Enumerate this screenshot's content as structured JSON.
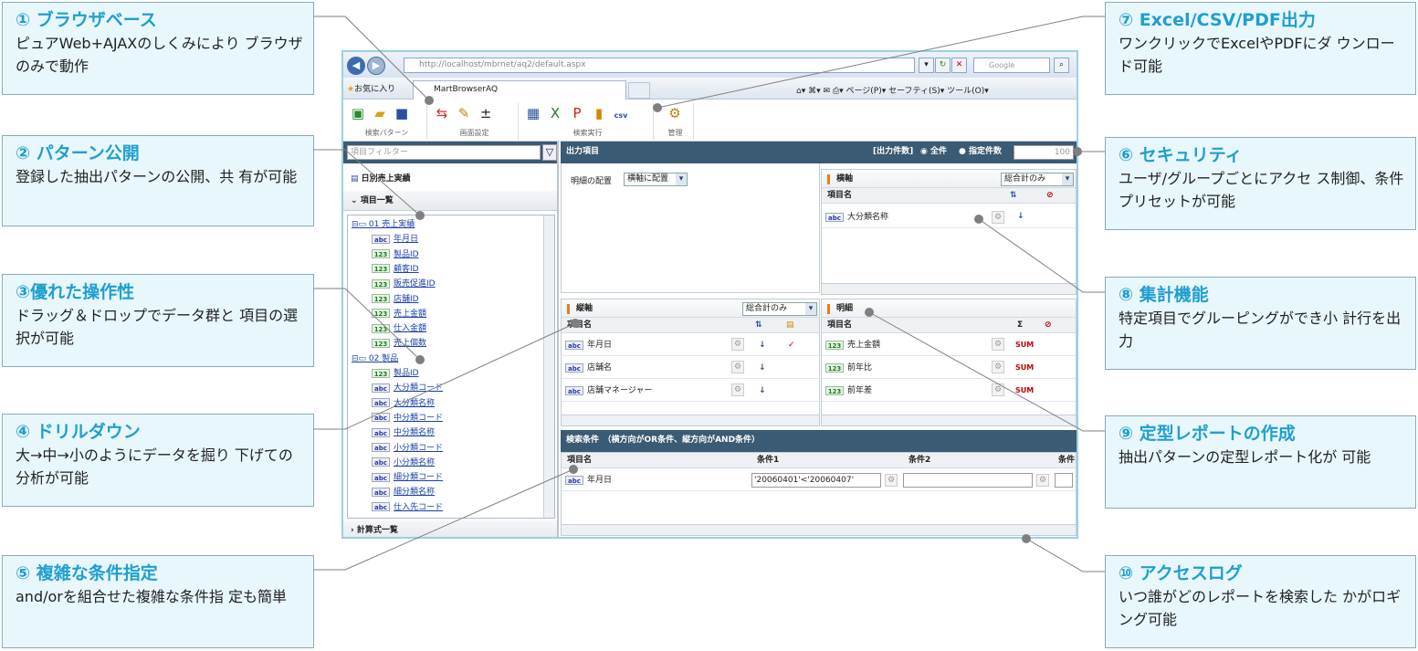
{
  "callouts": [
    {
      "title": "① ブラウザベース",
      "desc": "ピュアWeb+AJAXのしくみにより ブラウザのみで動作"
    },
    {
      "title": "② パターン公開",
      "desc": "登録した抽出パターンの公開、共 有が可能"
    },
    {
      "title": "③優れた操作性",
      "desc": "ドラッグ＆ドロップでデータ群と 項目の選択が可能"
    },
    {
      "title": "④ ドリルダウン",
      "desc": "大→中→小のようにデータを掘り 下げての分析が可能"
    },
    {
      "title": "⑤ 複雑な条件指定",
      "desc": "and/orを組合せた複雑な条件指 定も簡単"
    },
    {
      "title": "⑦ Excel/CSV/PDF出力",
      "desc": "ワンクリックでExcelやPDFにダ ウンロード可能"
    },
    {
      "title": "⑥ セキュリティ",
      "desc": "ユーザ/グループごとにアクセ ス制御、条件プリセットが可能"
    },
    {
      "title": "⑧ 集計機能",
      "desc": "特定項目でグルーピングができ小 計行を出力"
    },
    {
      "title": "⑨ 定型レポートの作成",
      "desc": "抽出パターンの定型レポート化が 可能"
    },
    {
      "title": "⑩ アクセスログ",
      "desc": "いつ誰がどのレポートを検索した かがロギング可能"
    }
  ],
  "browser": {
    "url": "http://localhost/mbrnet/aq2/default.aspx",
    "search_placeholder": "Google",
    "favorites": "お気に入り",
    "tab_title": "MartBrowserAQ",
    "tools": "ページ(P)▾  セーフティ(S)▾  ツール(O)▾"
  },
  "toolbar": {
    "groups": [
      "検索パターン",
      "画面設定",
      "検索実行",
      "管理"
    ],
    "csv": "csv"
  },
  "left": {
    "filter_placeholder": "項目フィルター",
    "pattern": "日別売上実績",
    "list_header": "項目一覧",
    "formula_header": "計算式一覧",
    "tree": [
      {
        "t": "folder",
        "label": "01 売上実績"
      },
      {
        "t": "abc",
        "label": "年月日"
      },
      {
        "t": "123",
        "label": "製品ID"
      },
      {
        "t": "123",
        "label": "顧客ID"
      },
      {
        "t": "123",
        "label": "販売促進ID"
      },
      {
        "t": "123",
        "label": "店舗ID"
      },
      {
        "t": "123",
        "label": "売上金額"
      },
      {
        "t": "123",
        "label": "仕入金額"
      },
      {
        "t": "123",
        "label": "売上個数"
      },
      {
        "t": "folder",
        "label": "02 製品"
      },
      {
        "t": "123",
        "label": "製品ID"
      },
      {
        "t": "abc",
        "label": "大分類コード"
      },
      {
        "t": "abc",
        "label": "大分類名称"
      },
      {
        "t": "abc",
        "label": "中分類コード"
      },
      {
        "t": "abc",
        "label": "中分類名称"
      },
      {
        "t": "abc",
        "label": "小分類コード"
      },
      {
        "t": "abc",
        "label": "小分類名称"
      },
      {
        "t": "abc",
        "label": "細分類コード"
      },
      {
        "t": "abc",
        "label": "細分類名称"
      },
      {
        "t": "abc",
        "label": "仕入先コード"
      }
    ]
  },
  "main": {
    "output_header": "出力項目",
    "count_label": "[出力件数]",
    "all_label": "全件",
    "specified_label": "指定件数",
    "count_value": "100",
    "detail_layout_label": "明細の配置",
    "detail_layout_value": "横軸に配置",
    "horizontal": {
      "title": "横軸",
      "select": "総合計のみ",
      "col": "項目名",
      "rows": [
        {
          "t": "abc",
          "label": "大分類名称"
        }
      ]
    },
    "vertical": {
      "title": "縦軸",
      "select": "総合計のみ",
      "col": "項目名",
      "rows": [
        {
          "t": "abc",
          "label": "年月日"
        },
        {
          "t": "abc",
          "label": "店舗名"
        },
        {
          "t": "abc",
          "label": "店舗マネージャー"
        }
      ]
    },
    "detail": {
      "title": "明細",
      "col": "項目名",
      "sigma": "Σ",
      "rows": [
        {
          "t": "123",
          "label": "売上金額",
          "agg": "SUM"
        },
        {
          "t": "123",
          "label": "前年比",
          "agg": "SUM"
        },
        {
          "t": "123",
          "label": "前年差",
          "agg": "SUM"
        }
      ]
    },
    "search": {
      "header": "検索条件　（横方向がOR条件、縦方向がAND条件）",
      "col_item": "項目名",
      "col_c1": "条件1",
      "col_c2": "条件2",
      "col_c3": "条件",
      "row_label": "年月日",
      "cond1_value": "'20060401'<'20060407'"
    }
  }
}
